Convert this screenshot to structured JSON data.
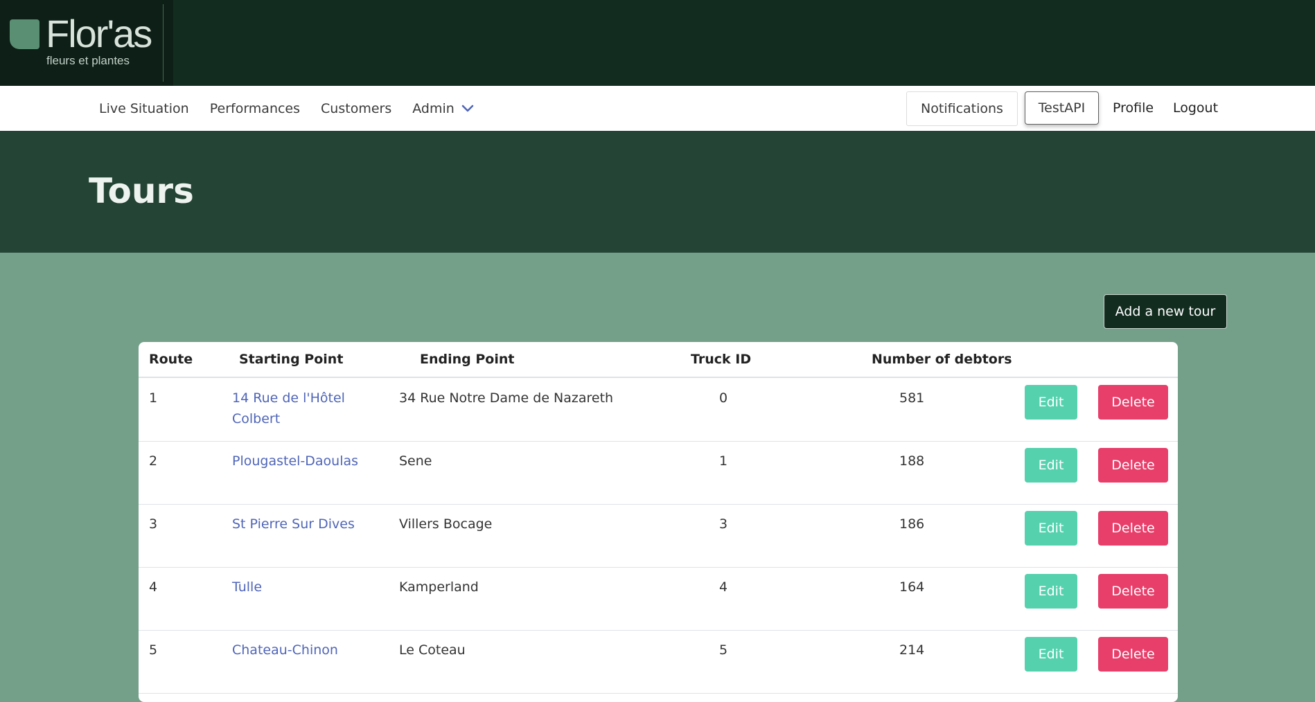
{
  "brand": {
    "name": "Flor'as",
    "tagline": "fleurs et plantes",
    "colors": {
      "header": "#132c20",
      "hero": "#244536",
      "page": "#74a08a",
      "link": "#4f65b8",
      "edit": "#55d1ae",
      "delete": "#e83e6a"
    }
  },
  "nav": {
    "left": [
      "Live Situation",
      "Performances",
      "Customers",
      "Admin"
    ],
    "admin_icon": "chevron-down-icon",
    "notifications": "Notifications",
    "testapi": "TestAPI",
    "profile": "Profile",
    "logout": "Logout"
  },
  "page": {
    "title": "Tours",
    "add_button": "Add a new tour"
  },
  "table": {
    "headers": [
      "Route",
      "Starting Point",
      "Ending Point",
      "Truck ID",
      "Number of debtors"
    ],
    "edit_label": "Edit",
    "delete_label": "Delete",
    "rows": [
      {
        "route": "1",
        "start": "14 Rue de l'Hôtel Colbert",
        "end": "34 Rue Notre Dame de Nazareth",
        "truck": "0",
        "debtors": "581"
      },
      {
        "route": "2",
        "start": "Plougastel-Daoulas",
        "end": "Sene",
        "truck": "1",
        "debtors": "188"
      },
      {
        "route": "3",
        "start": "St Pierre Sur Dives",
        "end": "Villers Bocage",
        "truck": "3",
        "debtors": "186"
      },
      {
        "route": "4",
        "start": "Tulle",
        "end": "Kamperland",
        "truck": "4",
        "debtors": "164"
      },
      {
        "route": "5",
        "start": "Chateau-Chinon",
        "end": "Le Coteau",
        "truck": "5",
        "debtors": "214"
      }
    ]
  }
}
